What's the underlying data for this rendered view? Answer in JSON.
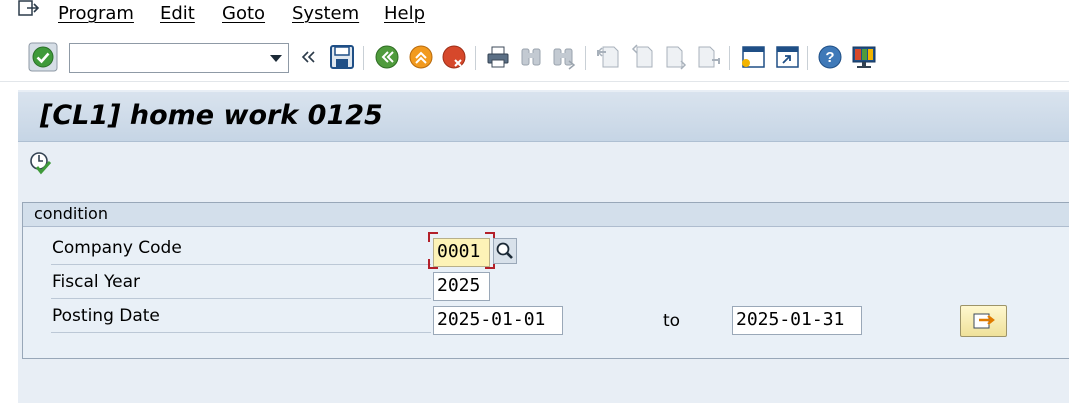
{
  "menu": {
    "items": [
      {
        "label": "Program",
        "name": "menu-program"
      },
      {
        "label": "Edit",
        "name": "menu-edit"
      },
      {
        "label": "Goto",
        "name": "menu-goto"
      },
      {
        "label": "System",
        "name": "menu-system"
      },
      {
        "label": "Help",
        "name": "menu-help"
      }
    ]
  },
  "toolbar": {
    "command_field_value": "",
    "icons": [
      "enter-icon",
      "command-dropdown-icon",
      "collapse-icon",
      "save-icon",
      "back-icon",
      "exit-icon",
      "cancel-icon",
      "print-icon",
      "find-icon",
      "find-next-icon",
      "first-page-icon",
      "previous-page-icon",
      "next-page-icon",
      "last-page-icon",
      "new-session-icon",
      "shortcut-icon",
      "help-icon",
      "customize-layout-icon"
    ]
  },
  "screen": {
    "title": "[CL1] home work 0125",
    "execute_icon": "execute-icon"
  },
  "selection": {
    "group_title": "condition",
    "company_code": {
      "label": "Company Code",
      "value": "0001"
    },
    "fiscal_year": {
      "label": "Fiscal Year",
      "value": "2025"
    },
    "posting_date": {
      "label": "Posting Date",
      "from": "2025-01-01",
      "to_label": "to",
      "to": "2025-01-31"
    }
  },
  "colors": {
    "title_bar": "#c6d5e5",
    "background": "#e8eef5",
    "required_field": "#fdf3b7",
    "focus_bracket": "#b3202a"
  }
}
